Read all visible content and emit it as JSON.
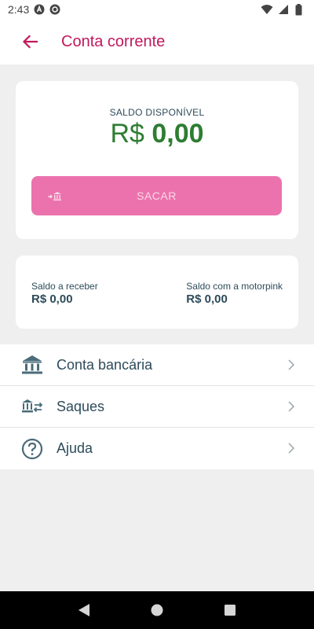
{
  "status_bar": {
    "time": "2:43",
    "icons": [
      "a-notification-icon",
      "at-notification-icon",
      "wifi-icon",
      "signal-icon",
      "battery-icon"
    ]
  },
  "header": {
    "title": "Conta corrente",
    "back_icon": "arrow-left-icon"
  },
  "balance": {
    "label": "SALDO DISPONÍVEL",
    "value": "R$ 0,00",
    "currency": "R$",
    "amount": "0,00",
    "withdraw_label": "SACAR",
    "withdraw_icon": "bank-transfer-icon"
  },
  "summary": {
    "receivable_label": "Saldo a receber",
    "receivable_value": "R$ 0,00",
    "motorpink_label": "Saldo com a motorpink",
    "motorpink_value": "R$ 0,00"
  },
  "menu": {
    "items": [
      {
        "label": "Conta bancária",
        "icon": "bank-icon"
      },
      {
        "label": "Saques",
        "icon": "bank-transfer-icon"
      },
      {
        "label": "Ajuda",
        "icon": "help-circle-icon"
      }
    ]
  },
  "colors": {
    "accent": "#c2185b",
    "button_bg": "#ec72ad",
    "balance_green": "#2e7d32",
    "text_dark": "#2d4b5a",
    "background": "#efefef"
  }
}
